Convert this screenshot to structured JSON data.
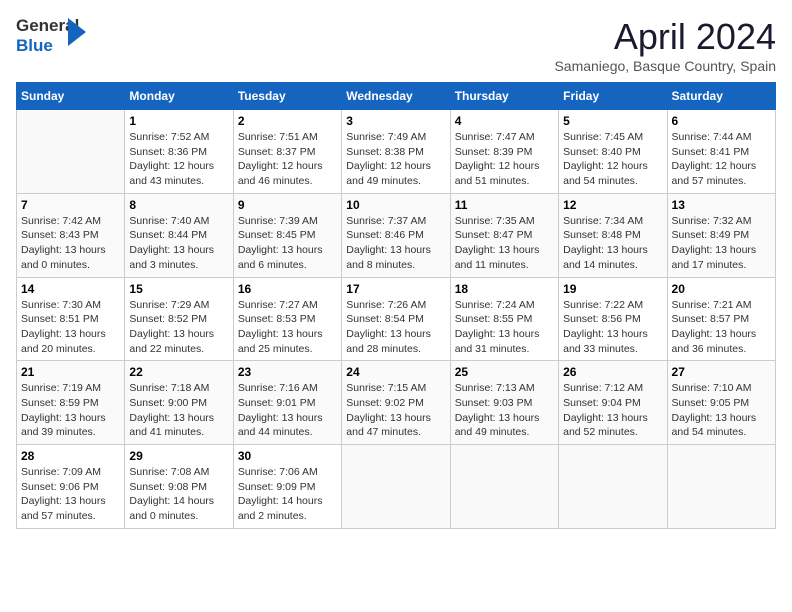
{
  "header": {
    "logo_general": "General",
    "logo_blue": "Blue",
    "month_title": "April 2024",
    "subtitle": "Samaniego, Basque Country, Spain"
  },
  "days_of_week": [
    "Sunday",
    "Monday",
    "Tuesday",
    "Wednesday",
    "Thursday",
    "Friday",
    "Saturday"
  ],
  "weeks": [
    [
      {
        "day": "",
        "content": ""
      },
      {
        "day": "1",
        "content": "Sunrise: 7:52 AM\nSunset: 8:36 PM\nDaylight: 12 hours\nand 43 minutes."
      },
      {
        "day": "2",
        "content": "Sunrise: 7:51 AM\nSunset: 8:37 PM\nDaylight: 12 hours\nand 46 minutes."
      },
      {
        "day": "3",
        "content": "Sunrise: 7:49 AM\nSunset: 8:38 PM\nDaylight: 12 hours\nand 49 minutes."
      },
      {
        "day": "4",
        "content": "Sunrise: 7:47 AM\nSunset: 8:39 PM\nDaylight: 12 hours\nand 51 minutes."
      },
      {
        "day": "5",
        "content": "Sunrise: 7:45 AM\nSunset: 8:40 PM\nDaylight: 12 hours\nand 54 minutes."
      },
      {
        "day": "6",
        "content": "Sunrise: 7:44 AM\nSunset: 8:41 PM\nDaylight: 12 hours\nand 57 minutes."
      }
    ],
    [
      {
        "day": "7",
        "content": "Sunrise: 7:42 AM\nSunset: 8:43 PM\nDaylight: 13 hours\nand 0 minutes."
      },
      {
        "day": "8",
        "content": "Sunrise: 7:40 AM\nSunset: 8:44 PM\nDaylight: 13 hours\nand 3 minutes."
      },
      {
        "day": "9",
        "content": "Sunrise: 7:39 AM\nSunset: 8:45 PM\nDaylight: 13 hours\nand 6 minutes."
      },
      {
        "day": "10",
        "content": "Sunrise: 7:37 AM\nSunset: 8:46 PM\nDaylight: 13 hours\nand 8 minutes."
      },
      {
        "day": "11",
        "content": "Sunrise: 7:35 AM\nSunset: 8:47 PM\nDaylight: 13 hours\nand 11 minutes."
      },
      {
        "day": "12",
        "content": "Sunrise: 7:34 AM\nSunset: 8:48 PM\nDaylight: 13 hours\nand 14 minutes."
      },
      {
        "day": "13",
        "content": "Sunrise: 7:32 AM\nSunset: 8:49 PM\nDaylight: 13 hours\nand 17 minutes."
      }
    ],
    [
      {
        "day": "14",
        "content": "Sunrise: 7:30 AM\nSunset: 8:51 PM\nDaylight: 13 hours\nand 20 minutes."
      },
      {
        "day": "15",
        "content": "Sunrise: 7:29 AM\nSunset: 8:52 PM\nDaylight: 13 hours\nand 22 minutes."
      },
      {
        "day": "16",
        "content": "Sunrise: 7:27 AM\nSunset: 8:53 PM\nDaylight: 13 hours\nand 25 minutes."
      },
      {
        "day": "17",
        "content": "Sunrise: 7:26 AM\nSunset: 8:54 PM\nDaylight: 13 hours\nand 28 minutes."
      },
      {
        "day": "18",
        "content": "Sunrise: 7:24 AM\nSunset: 8:55 PM\nDaylight: 13 hours\nand 31 minutes."
      },
      {
        "day": "19",
        "content": "Sunrise: 7:22 AM\nSunset: 8:56 PM\nDaylight: 13 hours\nand 33 minutes."
      },
      {
        "day": "20",
        "content": "Sunrise: 7:21 AM\nSunset: 8:57 PM\nDaylight: 13 hours\nand 36 minutes."
      }
    ],
    [
      {
        "day": "21",
        "content": "Sunrise: 7:19 AM\nSunset: 8:59 PM\nDaylight: 13 hours\nand 39 minutes."
      },
      {
        "day": "22",
        "content": "Sunrise: 7:18 AM\nSunset: 9:00 PM\nDaylight: 13 hours\nand 41 minutes."
      },
      {
        "day": "23",
        "content": "Sunrise: 7:16 AM\nSunset: 9:01 PM\nDaylight: 13 hours\nand 44 minutes."
      },
      {
        "day": "24",
        "content": "Sunrise: 7:15 AM\nSunset: 9:02 PM\nDaylight: 13 hours\nand 47 minutes."
      },
      {
        "day": "25",
        "content": "Sunrise: 7:13 AM\nSunset: 9:03 PM\nDaylight: 13 hours\nand 49 minutes."
      },
      {
        "day": "26",
        "content": "Sunrise: 7:12 AM\nSunset: 9:04 PM\nDaylight: 13 hours\nand 52 minutes."
      },
      {
        "day": "27",
        "content": "Sunrise: 7:10 AM\nSunset: 9:05 PM\nDaylight: 13 hours\nand 54 minutes."
      }
    ],
    [
      {
        "day": "28",
        "content": "Sunrise: 7:09 AM\nSunset: 9:06 PM\nDaylight: 13 hours\nand 57 minutes."
      },
      {
        "day": "29",
        "content": "Sunrise: 7:08 AM\nSunset: 9:08 PM\nDaylight: 14 hours\nand 0 minutes."
      },
      {
        "day": "30",
        "content": "Sunrise: 7:06 AM\nSunset: 9:09 PM\nDaylight: 14 hours\nand 2 minutes."
      },
      {
        "day": "",
        "content": ""
      },
      {
        "day": "",
        "content": ""
      },
      {
        "day": "",
        "content": ""
      },
      {
        "day": "",
        "content": ""
      }
    ]
  ]
}
